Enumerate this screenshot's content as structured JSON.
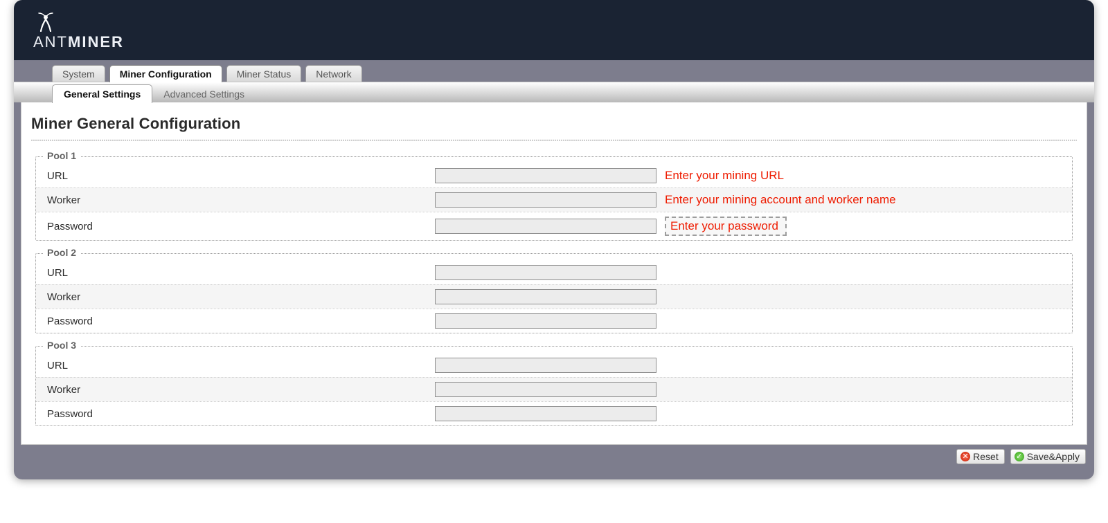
{
  "brand": {
    "line1": "ANT",
    "line2": "MINER"
  },
  "tabs": {
    "items": [
      "System",
      "Miner Configuration",
      "Miner Status",
      "Network"
    ],
    "activeIndex": 1
  },
  "subtabs": {
    "items": [
      "General Settings",
      "Advanced Settings"
    ],
    "activeIndex": 0
  },
  "page": {
    "title": "Miner General Configuration"
  },
  "field_labels": {
    "url": "URL",
    "worker": "Worker",
    "password": "Password"
  },
  "hints": {
    "url": "Enter your mining URL",
    "worker": "Enter your mining account and worker name",
    "password": "Enter your password"
  },
  "pools": [
    {
      "legend": "Pool 1",
      "url": "",
      "worker": "",
      "password": "",
      "show_hints": true
    },
    {
      "legend": "Pool 2",
      "url": "",
      "worker": "",
      "password": "",
      "show_hints": false
    },
    {
      "legend": "Pool 3",
      "url": "",
      "worker": "",
      "password": "",
      "show_hints": false
    }
  ],
  "actions": {
    "reset": "Reset",
    "save_apply": "Save&Apply"
  }
}
